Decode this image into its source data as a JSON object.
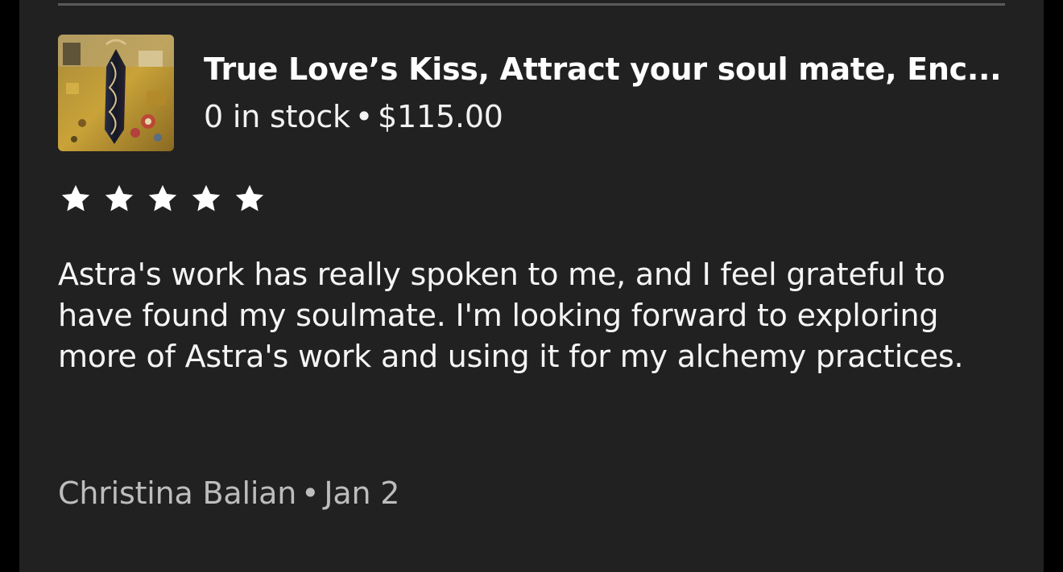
{
  "listing": {
    "title": "True Love’s Kiss, Attract your soul mate, Enc...",
    "stock": "0 in stock",
    "separator": "•",
    "price": "$115.00",
    "thumbnail_icon": "product-thumbnail"
  },
  "review": {
    "rating": 5,
    "rating_max": 5,
    "star_color": "#ffffff",
    "text": "Astra's work has really spoken to me, and I feel grateful to have found my soulmate. I'm looking forward to exploring more of Astra's work and using it for my alchemy practices.",
    "author": "Christina Balian",
    "separator": "•",
    "date": "Jan 2"
  },
  "colors": {
    "background": "#212121",
    "outer": "#000000",
    "divider": "#5a5a5a",
    "text_primary": "#ffffff",
    "text_secondary": "#bdbdbd"
  }
}
